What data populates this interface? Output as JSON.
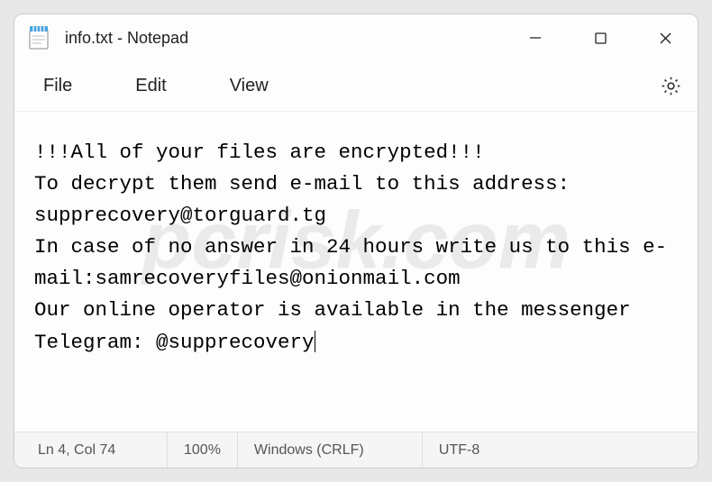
{
  "titlebar": {
    "title": "info.txt - Notepad"
  },
  "menu": {
    "file": "File",
    "edit": "Edit",
    "view": "View"
  },
  "content": {
    "text": "!!!All of your files are encrypted!!!\nTo decrypt them send e-mail to this address: supprecovery@torguard.tg\nIn case of no answer in 24 hours write us to this e-mail:samrecoveryfiles@onionmail.com\nOur online operator is available in the messenger Telegram: @supprecovery"
  },
  "statusbar": {
    "position": "Ln 4, Col 74",
    "zoom": "100%",
    "line_ending": "Windows (CRLF)",
    "encoding": "UTF-8"
  },
  "watermark": "pcrisk.com"
}
